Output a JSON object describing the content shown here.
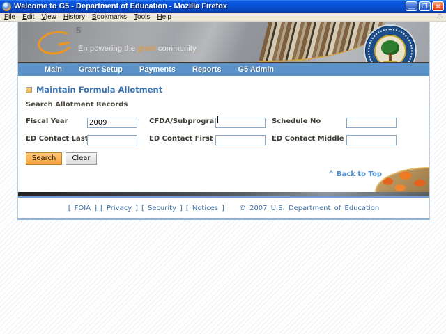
{
  "window": {
    "title": "Welcome to G5 - Department of Education - Mozilla Firefox",
    "controls": {
      "minimize": "—",
      "maximize": "❐",
      "close": "✕"
    }
  },
  "menu": {
    "items": [
      "File",
      "Edit",
      "View",
      "History",
      "Bookmarks",
      "Tools",
      "Help"
    ]
  },
  "banner": {
    "logo_sup": "5",
    "tagline_prefix": "Empowering the ",
    "tagline_highlight": "grant",
    "tagline_suffix": " community",
    "tagline_period": "."
  },
  "nav": {
    "items": [
      "Main",
      "Grant Setup",
      "Payments",
      "Reports",
      "G5 Admin"
    ]
  },
  "content": {
    "page_title": "Maintain Formula Allotment",
    "section_title": "Search Allotment Records",
    "back_to_top": "^ Back to Top"
  },
  "form": {
    "fields": [
      {
        "label": "Fiscal Year",
        "value": "2009"
      },
      {
        "label": "CFDA/Subprogram",
        "value": ""
      },
      {
        "label": "Schedule No",
        "value": ""
      },
      {
        "label": "ED Contact Last Name",
        "value": ""
      },
      {
        "label": "ED Contact First Name",
        "value": ""
      },
      {
        "label": "ED Contact Middle Initial",
        "value": ""
      }
    ],
    "buttons": {
      "search": "Search",
      "clear": "Clear"
    }
  },
  "footer": {
    "bracket_open": "[",
    "bracket_close": "]",
    "links": [
      "FOIA",
      "Privacy",
      "Security",
      "Notices"
    ],
    "copyright": "© 2007 U.S. Department of Education"
  },
  "colors": {
    "titlebar_blue": "#0a52d8",
    "nav_blue": "#5b92c8",
    "accent_orange": "#ef9421",
    "link_blue": "#3a6ea5"
  }
}
